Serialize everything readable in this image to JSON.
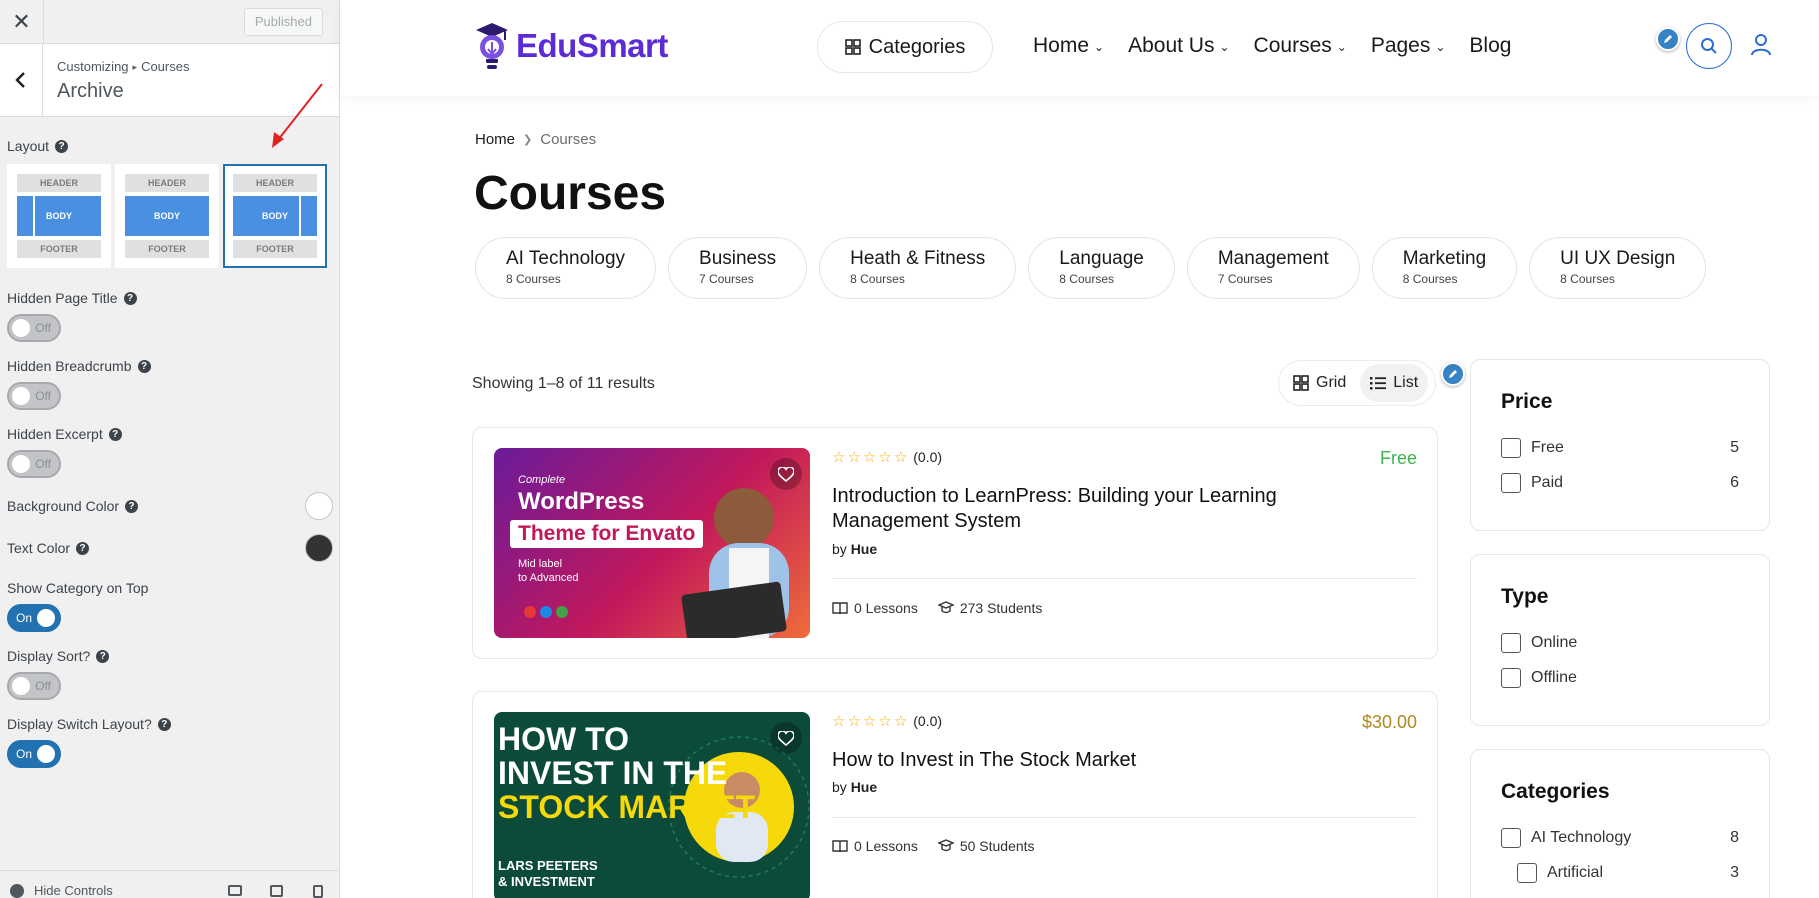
{
  "customizer": {
    "published_label": "Published",
    "breadcrumb": {
      "parent": "Customizing",
      "current": "Courses"
    },
    "section_title": "Archive",
    "layout": {
      "label": "Layout",
      "options": [
        {
          "header": "HEADER",
          "body": "BODY",
          "footer": "FOOTER",
          "sidebar": "left"
        },
        {
          "header": "HEADER",
          "body": "BODY",
          "footer": "FOOTER",
          "sidebar": "none"
        },
        {
          "header": "HEADER",
          "body": "BODY",
          "footer": "FOOTER",
          "sidebar": "right"
        }
      ],
      "selected_index": 2
    },
    "controls": {
      "hidden_page_title": {
        "label": "Hidden Page Title",
        "state": "Off"
      },
      "hidden_breadcrumb": {
        "label": "Hidden Breadcrumb",
        "state": "Off"
      },
      "hidden_excerpt": {
        "label": "Hidden Excerpt",
        "state": "Off"
      },
      "background_color": {
        "label": "Background Color",
        "value": "#ffffff"
      },
      "text_color": {
        "label": "Text Color",
        "value": "#333333"
      },
      "show_category_on_top": {
        "label": "Show Category on Top",
        "state": "On"
      },
      "display_sort": {
        "label": "Display Sort?",
        "state": "Off"
      },
      "display_switch_layout": {
        "label": "Display Switch Layout?",
        "state": "On"
      }
    },
    "footer": {
      "hide_controls": "Hide Controls"
    }
  },
  "site": {
    "logo_text": "EduSmart",
    "brand_color": "#5b2bd6",
    "categories_button": "Categories",
    "nav": [
      "Home",
      "About Us",
      "Courses",
      "Pages",
      "Blog"
    ],
    "breadcrumb": {
      "home": "Home",
      "current": "Courses"
    },
    "page_title": "Courses",
    "category_chips": [
      {
        "name": "AI Technology",
        "count": "8 Courses"
      },
      {
        "name": "Business",
        "count": "7 Courses"
      },
      {
        "name": "Heath & Fitness",
        "count": "8 Courses"
      },
      {
        "name": "Language",
        "count": "8 Courses"
      },
      {
        "name": "Management",
        "count": "7 Courses"
      },
      {
        "name": "Marketing",
        "count": "8 Courses"
      },
      {
        "name": "UI UX Design",
        "count": "8 Courses"
      }
    ],
    "results_text": "Showing 1–8 of 11 results",
    "view_switch": {
      "grid": "Grid",
      "list": "List",
      "active": "list"
    },
    "courses": [
      {
        "rating_count": "(0.0)",
        "price": "Free",
        "price_color": "#3bb54a",
        "title": "Introduction to LearnPress: Building your Learning Management System",
        "by_label": "by",
        "author": "Hue",
        "lessons": "0 Lessons",
        "students": "273 Students",
        "thumb": {
          "kicker": "Complete",
          "line1": "WordPress",
          "line2": "Theme for Envato",
          "line3": "Mid label",
          "line4": "to Advanced"
        }
      },
      {
        "rating_count": "(0.0)",
        "price": "$30.00",
        "price_color": "#b08a1e",
        "title": "How to Invest in The Stock Market",
        "by_label": "by",
        "author": "Hue",
        "lessons": "0 Lessons",
        "students": "50 Students",
        "thumb": {
          "line1": "HOW TO",
          "line2": "INVEST IN THE",
          "line3": "STOCK MARKET",
          "line4": "LARS PEETERS",
          "line5": "& INVESTMENT"
        }
      }
    ],
    "filters": {
      "price": {
        "title": "Price",
        "options": [
          {
            "label": "Free",
            "count": "5"
          },
          {
            "label": "Paid",
            "count": "6"
          }
        ]
      },
      "type": {
        "title": "Type",
        "options": [
          {
            "label": "Online"
          },
          {
            "label": "Offline"
          }
        ]
      },
      "categories": {
        "title": "Categories",
        "options": [
          {
            "label": "AI Technology",
            "count": "8"
          },
          {
            "label": "Artificial",
            "count": "3"
          }
        ]
      }
    }
  }
}
